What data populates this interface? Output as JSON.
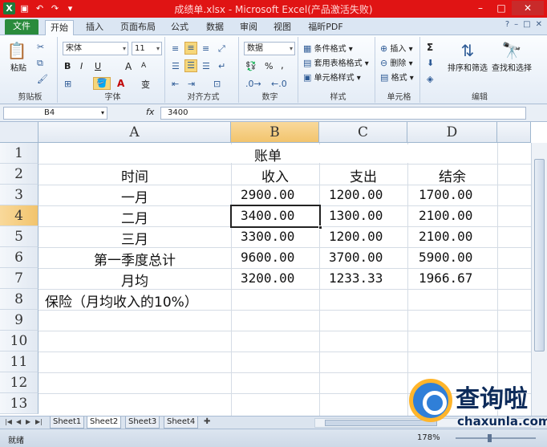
{
  "window": {
    "title": "成绩单.xlsx - Microsoft Excel(产品激活失败)"
  },
  "ribbon": {
    "tabs": [
      "文件",
      "开始",
      "插入",
      "页面布局",
      "公式",
      "数据",
      "审阅",
      "视图",
      "福昕PDF"
    ],
    "active_tab": "开始",
    "clipboard": {
      "paste": "粘贴",
      "label": "剪贴板"
    },
    "font": {
      "family": "宋体",
      "size": "11",
      "bold": "B",
      "italic": "I",
      "underline": "U",
      "grow": "A",
      "shrink": "A",
      "wen": "变",
      "label": "字体"
    },
    "alignment": {
      "label": "对齐方式"
    },
    "number": {
      "format": "数据",
      "percent": "%",
      "comma": ",",
      "label": "数字"
    },
    "styles": {
      "conditional": "条件格式",
      "table": "套用表格格式",
      "cell": "单元格样式",
      "label": "样式"
    },
    "cells": {
      "insert": "插入",
      "delete": "删除",
      "format": "格式",
      "label": "单元格"
    },
    "editing": {
      "sum": "Σ",
      "sort_filter": "排序和筛选",
      "find_select": "查找和选择",
      "label": "编辑"
    }
  },
  "formula_bar": {
    "name_box": "B4",
    "fx": "fx",
    "value": "3400"
  },
  "sheet": {
    "columns": [
      "A",
      "B",
      "C",
      "D"
    ],
    "selected_column": "B",
    "selected_row": "4",
    "rows": [
      "1",
      "2",
      "3",
      "4",
      "5",
      "6",
      "7",
      "8",
      "9",
      "10",
      "11",
      "12",
      "13"
    ],
    "title": "账单",
    "header": {
      "time": "时间",
      "income": "收入",
      "expense": "支出",
      "balance": "结余"
    },
    "data": [
      {
        "label": "一月",
        "income": "2900.00",
        "expense": "1200.00",
        "balance": "1700.00"
      },
      {
        "label": "二月",
        "income": "3400.00",
        "expense": "1300.00",
        "balance": "2100.00"
      },
      {
        "label": "三月",
        "income": "3300.00",
        "expense": "1200.00",
        "balance": "2100.00"
      },
      {
        "label": "第一季度总计",
        "income": "9600.00",
        "expense": "3700.00",
        "balance": "5900.00"
      },
      {
        "label": "月均",
        "income": "3200.00",
        "expense": "1233.33",
        "balance": "1966.67"
      }
    ],
    "note": "保险（月均收入的10%）"
  },
  "sheet_tabs": [
    "Sheet1",
    "Sheet2",
    "Sheet3",
    "Sheet4"
  ],
  "active_sheet": "Sheet2",
  "status": {
    "ready": "就绪",
    "zoom": "178%"
  },
  "watermark": {
    "cn": "查询啦",
    "en": "chaxunla.com"
  }
}
